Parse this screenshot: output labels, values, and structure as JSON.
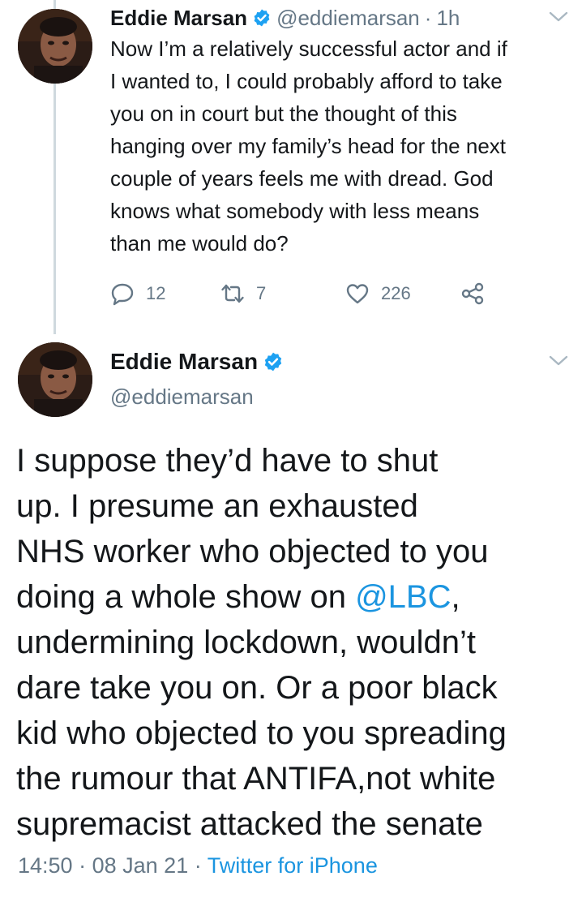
{
  "reply_tweet": {
    "name": "Eddie Marsan",
    "handle": "@eddiemarsan",
    "separator": "·",
    "time_ago": "1h",
    "text": "Now I’m a relatively successful actor and if\nI wanted to, I could probably afford to take\nyou on in court but the thought of this\nhanging over my family’s head for the next\ncouple of years feels me with dread. God\nknows what somebody with less means\nthan me would do?",
    "actions": {
      "replies": "12",
      "retweets": "7",
      "likes": "226"
    },
    "icons": [
      "reply-icon",
      "retweet-icon",
      "like-icon",
      "share-icon",
      "verified-badge-icon",
      "chevron-down-icon"
    ]
  },
  "main_tweet": {
    "name": "Eddie Marsan",
    "handle": "@eddiemarsan",
    "text_lines": [
      "I suppose they’d have to shut",
      "up. I presume an exhausted",
      "NHS worker who objected to you",
      {
        "before": "doing a whole show on ",
        "mention": "@LBC",
        "after": ","
      },
      "undermining lockdown, wouldn’t",
      "dare take you on. Or a poor black",
      "kid who objected to you spreading",
      "the rumour that ANTIFA,not white",
      "supremacist attacked the senate"
    ],
    "meta": {
      "time": "14:50",
      "separator": "·",
      "date": "08 Jan 21",
      "source": "Twitter for iPhone"
    }
  },
  "colors": {
    "text": "#14171a",
    "muted": "#657786",
    "link": "#1b95e0",
    "verified": "#1da1f2",
    "thread_line": "#cfd9de"
  }
}
